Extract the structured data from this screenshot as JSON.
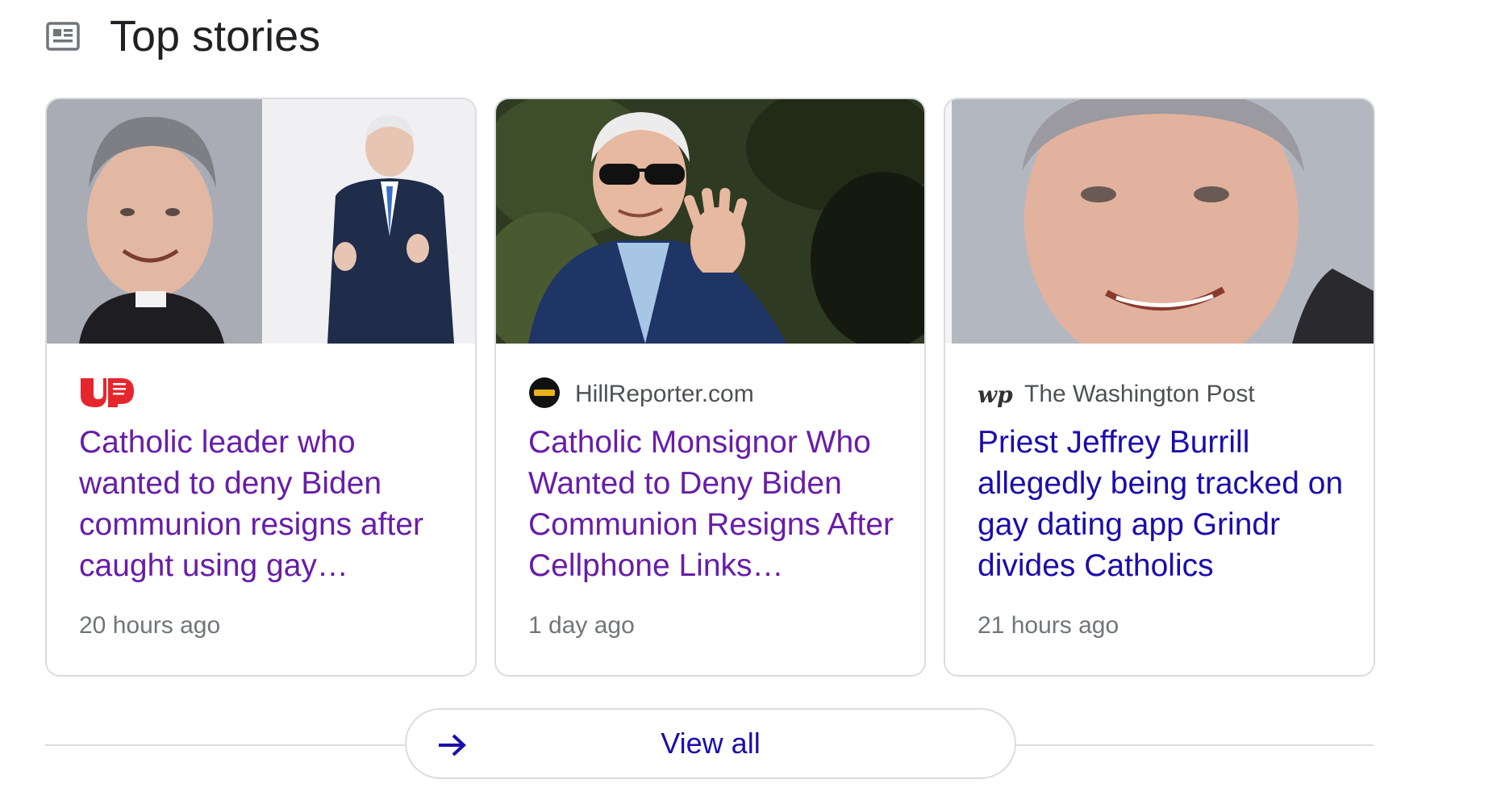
{
  "section": {
    "title": "Top stories",
    "icon": "news-icon"
  },
  "stories": [
    {
      "source_name": "",
      "source_logo": "upworthy-logo-icon",
      "headline": "Catholic leader who wanted to deny Biden communion resigns after caught using gay…",
      "time": "20 hours ago",
      "visited": true
    },
    {
      "source_name": "HillReporter.com",
      "source_logo": "hillreporter-logo-icon",
      "headline": "Catholic Monsignor Who Wanted to Deny Biden Communion Resigns After Cellphone Links…",
      "time": "1 day ago",
      "visited": true
    },
    {
      "source_name": "The Washington Post",
      "source_logo": "washington-post-logo-icon",
      "source_logo_text": "wp",
      "headline": "Priest Jeffrey Burrill allegedly being tracked on gay dating app Grindr divides Catholics",
      "time": "21 hours ago",
      "visited": false
    }
  ],
  "view_all": {
    "label": "View all",
    "icon": "arrow-right-icon"
  },
  "colors": {
    "visited_link": "#681da8",
    "unvisited_link": "#1a0dab",
    "title_text": "#202124",
    "meta_text": "#70757a",
    "border": "#dadce0"
  }
}
